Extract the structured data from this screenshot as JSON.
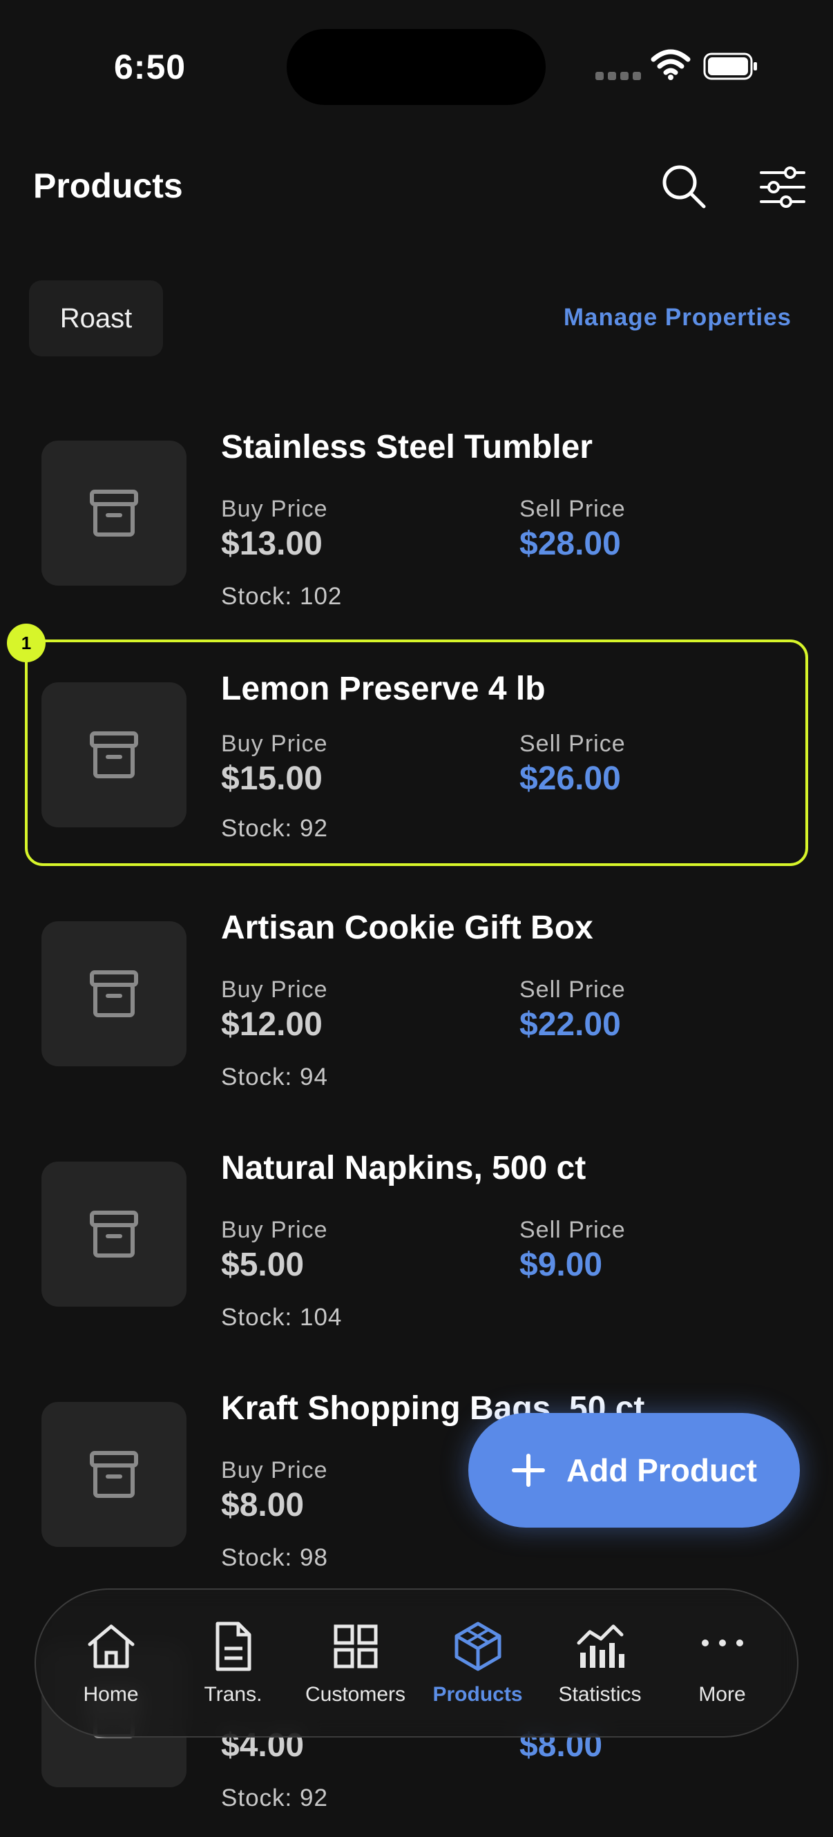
{
  "status": {
    "time": "6:50"
  },
  "header": {
    "title": "Products"
  },
  "filter": {
    "chip": "Roast",
    "manage_label": "Manage Properties"
  },
  "labels": {
    "buy": "Buy Price",
    "sell": "Sell Price"
  },
  "products": [
    {
      "name": "Stainless Steel Tumbler",
      "buy": "$13.00",
      "sell": "$28.00",
      "stock": "Stock: 102"
    },
    {
      "name": "Lemon Preserve 4 lb",
      "buy": "$15.00",
      "sell": "$26.00",
      "stock": "Stock: 92"
    },
    {
      "name": "Artisan Cookie Gift Box",
      "buy": "$12.00",
      "sell": "$22.00",
      "stock": "Stock: 94"
    },
    {
      "name": "Natural Napkins, 500 ct",
      "buy": "$5.00",
      "sell": "$9.00",
      "stock": "Stock: 104"
    },
    {
      "name": "Kraft Shopping Bags, 50 ct",
      "buy": "$8.00",
      "sell": "",
      "stock": "Stock: 98"
    },
    {
      "name": "",
      "buy": "$4.00",
      "sell": "$8.00",
      "stock": "Stock: 92"
    }
  ],
  "highlight_badge": "1",
  "fab": {
    "label": "Add Product",
    "icon": "plus-icon"
  },
  "tabs": [
    {
      "label": "Home",
      "icon": "home-icon"
    },
    {
      "label": "Trans.",
      "icon": "document-icon"
    },
    {
      "label": "Customers",
      "icon": "grid-icon"
    },
    {
      "label": "Products",
      "icon": "cube-icon",
      "active": true
    },
    {
      "label": "Statistics",
      "icon": "chart-icon"
    },
    {
      "label": "More",
      "icon": "more-icon"
    }
  ],
  "colors": {
    "accent": "#5c8ee6",
    "highlight": "#d7f52a",
    "background": "#121212"
  }
}
